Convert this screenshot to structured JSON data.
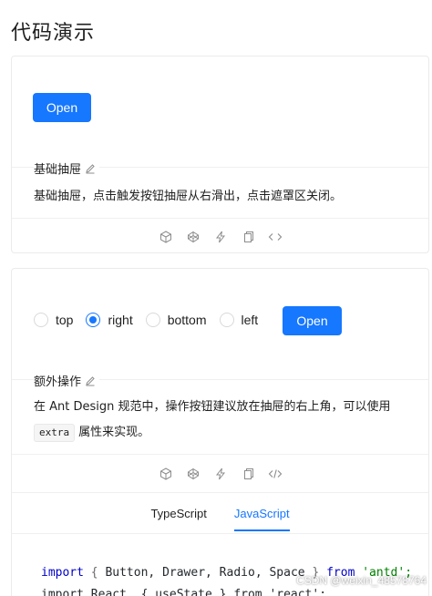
{
  "page": {
    "title": "代码演示"
  },
  "demo1": {
    "open_label": "Open",
    "meta_title": "基础抽屉",
    "description": "基础抽屉，点击触发按钮抽屉从右滑出，点击遮罩区关闭。"
  },
  "demo2": {
    "radios": [
      {
        "label": "top",
        "checked": false
      },
      {
        "label": "right",
        "checked": true
      },
      {
        "label": "bottom",
        "checked": false
      },
      {
        "label": "left",
        "checked": false
      }
    ],
    "open_label": "Open",
    "meta_title": "额外操作",
    "description_prefix": "在 Ant Design 规范中，操作按钮建议放在抽屉的右上角，可以使用",
    "code_token": "extra",
    "description_suffix": "属性来实现。",
    "tabs": [
      {
        "label": "TypeScript",
        "active": false
      },
      {
        "label": "JavaScript",
        "active": true
      }
    ],
    "code": {
      "line1": {
        "kw_import": "import",
        "brace_open": " { ",
        "names": "Button, Drawer, Radio, Space",
        "brace_close": " } ",
        "kw_from": "from",
        "module": " 'antd';"
      },
      "line2_partial": "import React, { useState } from 'react';"
    }
  },
  "icons": [
    "codesandbox-icon",
    "codepen-icon",
    "thunder-icon",
    "copy-icon",
    "code-expand-icon"
  ],
  "colors": {
    "primary": "#1677ff",
    "border": "#ebebeb",
    "icon": "#8c8c8c"
  },
  "watermark": "CSDN @weixin_48578764"
}
